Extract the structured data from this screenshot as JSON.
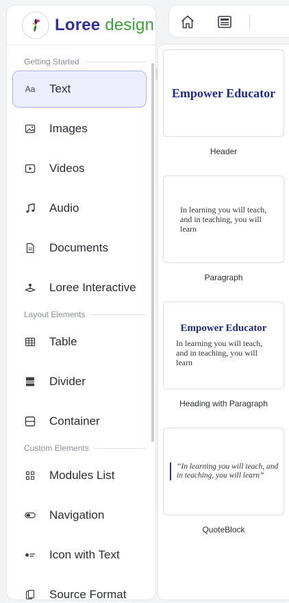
{
  "app": {
    "logo_primary": "Loree",
    "logo_secondary": "design"
  },
  "sidebar": {
    "sections": [
      {
        "label": "Getting Started",
        "items": [
          {
            "label": "Text",
            "icon": "text-aa-icon",
            "active": true
          },
          {
            "label": "Images",
            "icon": "image-icon"
          },
          {
            "label": "Videos",
            "icon": "video-icon"
          },
          {
            "label": "Audio",
            "icon": "music-note-icon"
          },
          {
            "label": "Documents",
            "icon": "document-icon"
          },
          {
            "label": "Loree Interactive",
            "icon": "interactive-icon"
          }
        ]
      },
      {
        "label": "Layout Elements",
        "items": [
          {
            "label": "Table",
            "icon": "table-icon"
          },
          {
            "label": "Divider",
            "icon": "divider-icon"
          },
          {
            "label": "Container",
            "icon": "container-icon"
          }
        ]
      },
      {
        "label": "Custom Elements",
        "items": [
          {
            "label": "Modules List",
            "icon": "grid-icon"
          },
          {
            "label": "Navigation",
            "icon": "toggle-icon"
          },
          {
            "label": "Icon with Text",
            "icon": "icon-text-icon"
          },
          {
            "label": "Source Format",
            "icon": "source-format-icon"
          }
        ]
      }
    ]
  },
  "toolbar": {
    "buttons": [
      {
        "icon": "home-icon"
      },
      {
        "icon": "newspaper-icon"
      }
    ]
  },
  "components": [
    {
      "caption": "Header",
      "heading": "Empower Educator"
    },
    {
      "caption": "Paragraph",
      "text": "In learning you will teach, and in teaching, you will learn"
    },
    {
      "caption": "Heading with Paragraph",
      "heading": "Empower Educator",
      "text": "In learning you will teach, and in teaching, you will learn"
    },
    {
      "caption": "QuoteBlock",
      "quote": "“In learning you will teach, and in teaching, you will learn”"
    }
  ],
  "colors": {
    "brand_primary": "#2b2f9a",
    "brand_secondary": "#3aa336",
    "active_item_bg": "#eceefc",
    "active_item_border": "#aeb4ee",
    "heading_blue": "#1f2a8a"
  }
}
